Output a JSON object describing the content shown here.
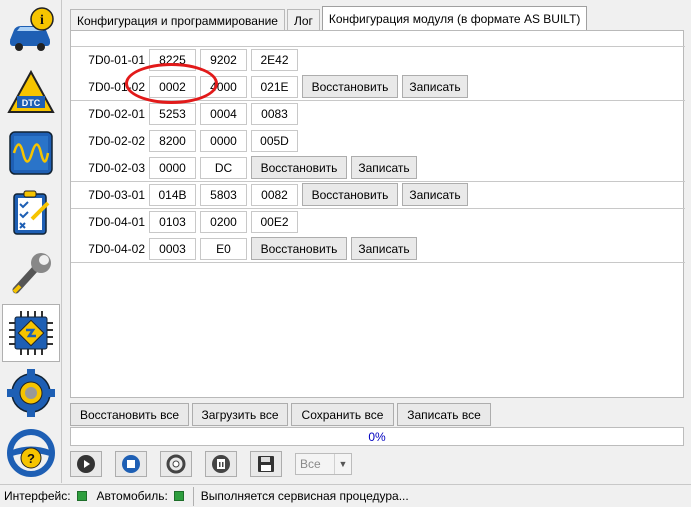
{
  "tabs": [
    {
      "label": "Конфигурация и программирование"
    },
    {
      "label": "Лог"
    },
    {
      "label": "Конфигурация модуля (в формате AS BUILT)"
    }
  ],
  "modules": [
    {
      "id": "7D0-01-01",
      "values": [
        "8225",
        "9202",
        "2E42"
      ]
    },
    {
      "id": "7D0-01-02",
      "values": [
        "0002",
        "4000",
        "021E"
      ],
      "restore": "Восстановить",
      "write": "Записать"
    },
    {
      "id": "7D0-02-01",
      "values": [
        "5253",
        "0004",
        "0083"
      ]
    },
    {
      "id": "7D0-02-02",
      "values": [
        "8200",
        "0000",
        "005D"
      ]
    },
    {
      "id": "7D0-02-03",
      "values": [
        "0000",
        "DC"
      ],
      "restore": "Восстановить",
      "write": "Записать"
    },
    {
      "id": "7D0-03-01",
      "values": [
        "014B",
        "5803",
        "0082"
      ],
      "restore": "Восстановить",
      "write": "Записать"
    },
    {
      "id": "7D0-04-01",
      "values": [
        "0103",
        "0200",
        "00E2"
      ]
    },
    {
      "id": "7D0-04-02",
      "values": [
        "0003",
        "E0"
      ],
      "restore": "Восстановить",
      "write": "Записать"
    }
  ],
  "actions": {
    "restore_all": "Восстановить все",
    "load_all": "Загрузить все",
    "save_all": "Сохранить все",
    "write_all": "Записать все"
  },
  "progress": {
    "text": "0%",
    "value": 0
  },
  "toolbar": {
    "select_value": "Все"
  },
  "status": {
    "interface_label": "Интерфейс:",
    "vehicle_label": "Автомобиль:",
    "message": "Выполняется сервисная процедура..."
  },
  "colors": {
    "highlight": "#e21a1a",
    "led": "#2e9e3e",
    "progress_text": "#0000c0"
  }
}
